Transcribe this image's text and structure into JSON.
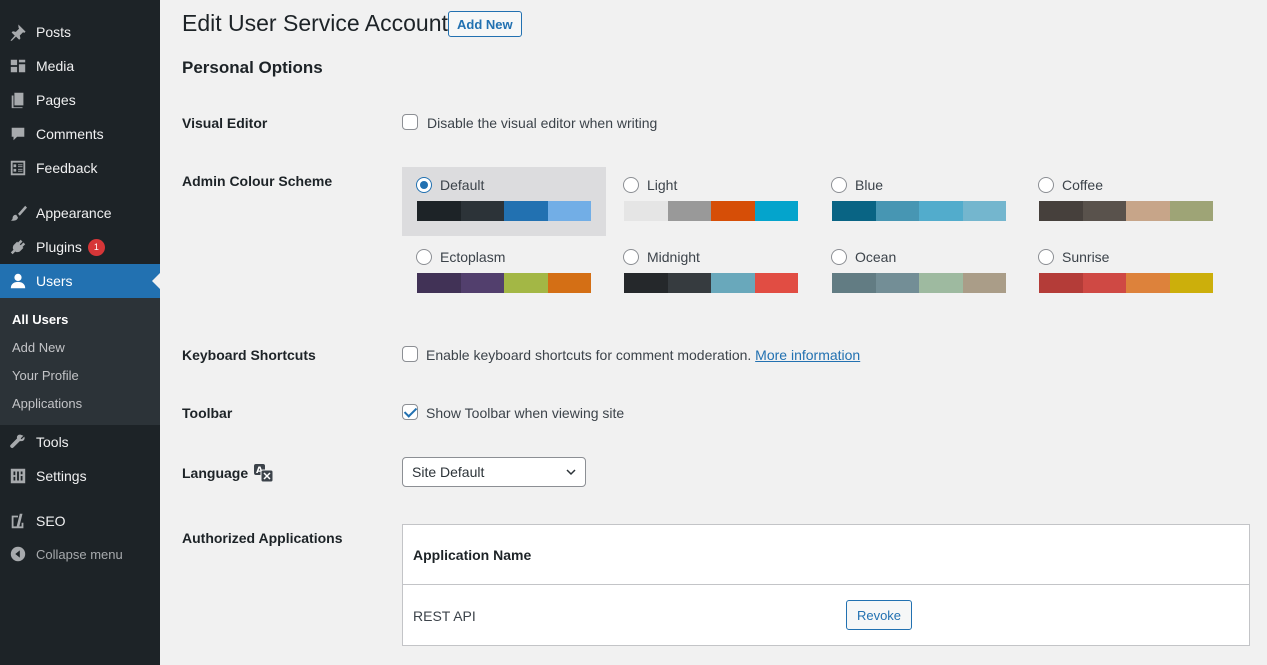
{
  "sidebar": {
    "items": [
      {
        "label": "Posts",
        "icon": "pin-icon"
      },
      {
        "label": "Media",
        "icon": "media-icon"
      },
      {
        "label": "Pages",
        "icon": "pages-icon"
      },
      {
        "label": "Comments",
        "icon": "comment-icon"
      },
      {
        "label": "Feedback",
        "icon": "feedback-icon"
      },
      {
        "label": "Appearance",
        "icon": "brush-icon"
      },
      {
        "label": "Plugins",
        "icon": "plugin-icon",
        "badge": "1"
      },
      {
        "label": "Users",
        "icon": "user-icon"
      },
      {
        "label": "Tools",
        "icon": "wrench-icon"
      },
      {
        "label": "Settings",
        "icon": "settings-icon"
      },
      {
        "label": "SEO",
        "icon": "yoast-icon"
      },
      {
        "label": "Collapse menu",
        "icon": "collapse-icon"
      }
    ],
    "submenu": [
      "All Users",
      "Add New",
      "Your Profile",
      "Applications"
    ],
    "accent": "#2271b1"
  },
  "header": {
    "title": "Edit User Service Account",
    "add_new": "Add New"
  },
  "section_title": "Personal Options",
  "visual_editor": {
    "label": "Visual Editor",
    "checkbox_text": "Disable the visual editor when writing",
    "checked": false
  },
  "colour_scheme": {
    "label": "Admin Colour Scheme",
    "selected": "Default",
    "schemes": [
      {
        "name": "Default",
        "colors": [
          "#1d2327",
          "#2c3338",
          "#2271b1",
          "#72aee6"
        ]
      },
      {
        "name": "Light",
        "colors": [
          "#e5e5e5",
          "#999999",
          "#d64e07",
          "#04a4cc"
        ]
      },
      {
        "name": "Blue",
        "colors": [
          "#096484",
          "#4796b3",
          "#52accc",
          "#74B6CE"
        ]
      },
      {
        "name": "Coffee",
        "colors": [
          "#46403c",
          "#59524c",
          "#c7a589",
          "#9ea476"
        ]
      },
      {
        "name": "Ectoplasm",
        "colors": [
          "#413256",
          "#523f6d",
          "#a3b745",
          "#d46f15"
        ]
      },
      {
        "name": "Midnight",
        "colors": [
          "#25282b",
          "#363b3f",
          "#69a8bb",
          "#e14d43"
        ]
      },
      {
        "name": "Ocean",
        "colors": [
          "#627c83",
          "#738e96",
          "#9ebaa0",
          "#aa9d88"
        ]
      },
      {
        "name": "Sunrise",
        "colors": [
          "#b43c38",
          "#cf4944",
          "#dd823b",
          "#ccaf0b"
        ]
      }
    ]
  },
  "keyboard_shortcuts": {
    "label": "Keyboard Shortcuts",
    "checkbox_text": "Enable keyboard shortcuts for comment moderation.",
    "link_text": "More information",
    "checked": false
  },
  "toolbar": {
    "label": "Toolbar",
    "checkbox_text": "Show Toolbar when viewing site",
    "checked": true
  },
  "language": {
    "label": "Language",
    "value": "Site Default"
  },
  "authorized_apps": {
    "label": "Authorized Applications",
    "column_header": "Application Name",
    "rows": [
      {
        "name": "REST API",
        "action": "Revoke"
      }
    ]
  }
}
